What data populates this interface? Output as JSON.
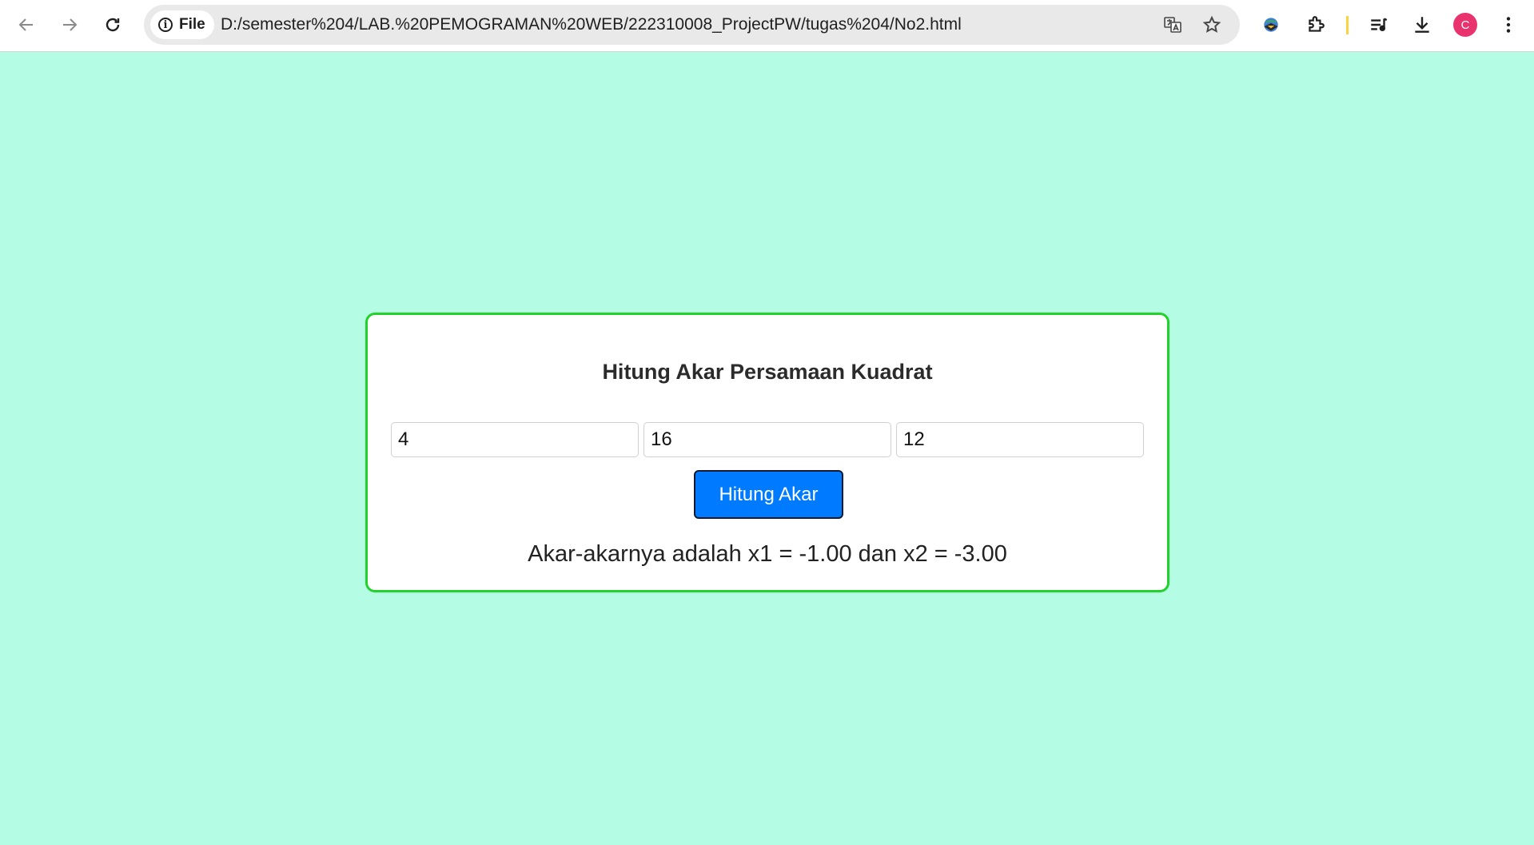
{
  "browser": {
    "site_chip_label": "File",
    "url": "D:/semester%204/LAB.%20PEMOGRAMAN%20WEB/222310008_ProjectPW/tugas%204/No2.html",
    "profile_initial": "C",
    "icons": [
      "back-icon",
      "forward-icon",
      "reload-icon",
      "info-icon",
      "translate-icon",
      "bookmark-star-icon",
      "idm-extension-icon",
      "extensions-puzzle-icon",
      "media-queue-icon",
      "download-icon",
      "more-menu-icon"
    ]
  },
  "page": {
    "background_color": "#b4fde4",
    "card_border_color": "#22d22a",
    "title": "Hitung Akar Persamaan Kuadrat",
    "inputs": [
      {
        "value": "4"
      },
      {
        "value": "16"
      },
      {
        "value": "12"
      }
    ],
    "button_label": "Hitung Akar",
    "button_color": "#007bff",
    "result_text": "Akar-akarnya adalah x1 = -1.00 dan x2 = -3.00"
  }
}
